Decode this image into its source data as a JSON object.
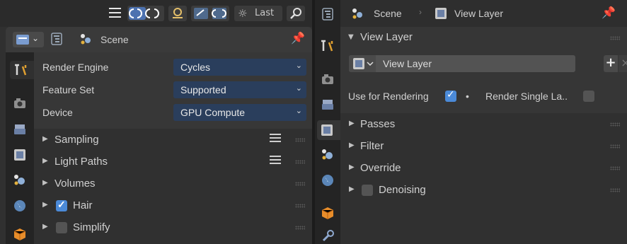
{
  "left_editor": {
    "topbar": {
      "menu_icon": "hamburger-icon",
      "last_label": "Last"
    },
    "header": {
      "scene_label": "Scene"
    },
    "properties": [
      {
        "label": "Render Engine",
        "value": "Cycles"
      },
      {
        "label": "Feature Set",
        "value": "Supported"
      },
      {
        "label": "Device",
        "value": "GPU Compute"
      }
    ],
    "panels": [
      {
        "label": "Sampling",
        "checkbox": null,
        "list_icon": true
      },
      {
        "label": "Light Paths",
        "checkbox": null,
        "list_icon": true
      },
      {
        "label": "Volumes",
        "checkbox": null,
        "list_icon": false
      },
      {
        "label": "Hair",
        "checkbox": true,
        "list_icon": false
      },
      {
        "label": "Simplify",
        "checkbox": false,
        "list_icon": false
      }
    ]
  },
  "right_editor": {
    "header": {
      "scene_label": "Scene",
      "view_layer_label": "View Layer"
    },
    "view_layer_panel": {
      "title": "View Layer",
      "field_value": "View Layer",
      "use_for_rendering_label": "Use for Rendering",
      "use_for_rendering": true,
      "render_single_label": "Render Single La..",
      "render_single": false
    },
    "panels": [
      {
        "label": "Passes",
        "checkbox": null
      },
      {
        "label": "Filter",
        "checkbox": null
      },
      {
        "label": "Override",
        "checkbox": null
      },
      {
        "label": "Denoising",
        "checkbox": false
      }
    ]
  },
  "colors": {
    "accent_blue": "#4b8ad8",
    "dropdown_bg": "#2a3e5c"
  }
}
